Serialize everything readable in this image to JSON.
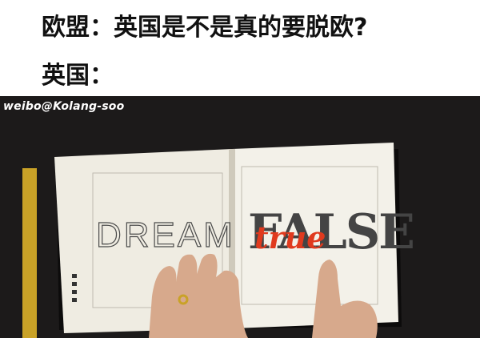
{
  "captions": {
    "line1": "欧盟：英国是不是真的要脱欧?",
    "line2": "英国："
  },
  "watermark": "weibo@Kolang-soo",
  "book": {
    "left_page_word": "DREAM",
    "right_page_word": "FALSE",
    "overlay_word": "true"
  },
  "colors": {
    "overlay_red": "#e03a1e",
    "false_gray": "#444444",
    "page": "#f1efe6",
    "backdrop": "#1c1a1a"
  }
}
